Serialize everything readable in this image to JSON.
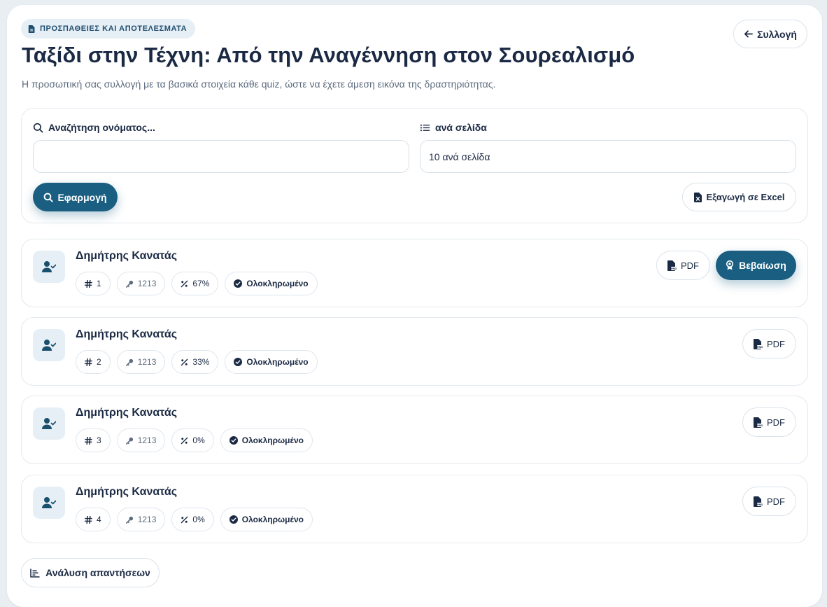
{
  "header": {
    "badge": "ΠΡΟΣΠΑΘΕΙΕΣ ΚΑΙ ΑΠΟΤΕΛΕΣΜΑΤΑ",
    "title": "Ταξίδι στην Τέχνη: Από την Αναγέννηση στον Σουρεαλισμό",
    "subtitle": "Η προσωπική σας συλλογή με τα βασικά στοιχεία κάθε quiz, ώστε να έχετε άμεση εικόνα της δραστηριότητας.",
    "back_label": "Συλλογή"
  },
  "filters": {
    "search_label": "Αναζήτηση ονόματος...",
    "search_value": "",
    "per_page_label": "ανά σελίδα",
    "per_page_value": "10 ανά σελίδα",
    "apply_label": "Εφαρμογή",
    "export_label": "Εξαγωγή σε Excel"
  },
  "attempts": [
    {
      "name": "Δημήτρης Κανατάς",
      "number": "1",
      "code": "1213",
      "score": "67%",
      "status": "Ολοκληρωμένο"
    },
    {
      "name": "Δημήτρης Κανατάς",
      "number": "2",
      "code": "1213",
      "score": "33%",
      "status": "Ολοκληρωμένο"
    },
    {
      "name": "Δημήτρης Κανατάς",
      "number": "3",
      "code": "1213",
      "score": "0%",
      "status": "Ολοκληρωμένο"
    },
    {
      "name": "Δημήτρης Κανατάς",
      "number": "4",
      "code": "1213",
      "score": "0%",
      "status": "Ολοκληρωμένο"
    }
  ],
  "actions": {
    "pdf_label": "PDF",
    "certificate_label": "Βεβαίωση",
    "analysis_label": "Ανάλυση απαντήσεων"
  },
  "colors": {
    "primary": "#1a5f82",
    "text": "#1b2a44",
    "badge_bg": "#e6eff6",
    "background": "#e9eef3"
  },
  "icons": {
    "badge": "file-icon",
    "back": "arrow-left-icon",
    "search": "search-icon",
    "list": "list-icon",
    "excel": "file-excel-icon",
    "avatar": "user-check-icon",
    "hash": "hash-icon",
    "key": "key-icon",
    "percent": "percent-icon",
    "status": "check-circle-icon",
    "pdf": "file-pdf-icon",
    "certificate": "award-icon",
    "analysis": "chart-bar-icon"
  }
}
